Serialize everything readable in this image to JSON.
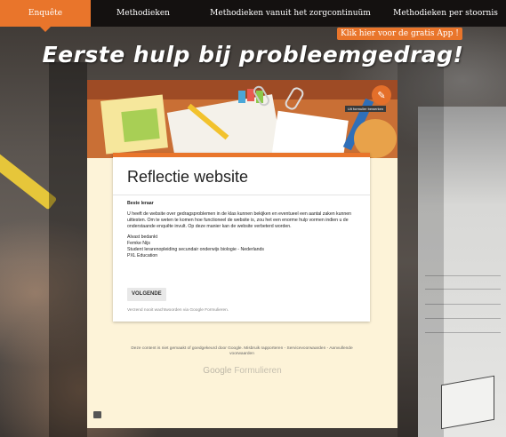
{
  "nav": {
    "items": [
      {
        "label": "Enquête",
        "active": true
      },
      {
        "label": "Methodieken",
        "active": false
      },
      {
        "label": "Methodieken vanuit het zorgcontinuüm",
        "active": false
      },
      {
        "label": "Methodieken per stoornis",
        "active": false
      }
    ]
  },
  "app_banner": "Klik hier voor de gratis App !",
  "headline": "Eerste hulp bij probleemgedrag!",
  "form": {
    "edit_tooltip": "Uit formulier bewerken",
    "title": "Reflectie website",
    "greeting": "Beste leraar",
    "intro": "U heeft de website over gedragsproblemen in de klas kunnen bekijken en eventueel een aantal zaken kunnen uittesten. Om te weten te komen hoe functioneel de website is, zou het een enorme hulp vormen indien u de onderstaande enquête invult. Op deze manier kan de website verbeterd worden.",
    "thanks": "Alvast bedankt",
    "signature_name": "Femke Nijs",
    "signature_role": "Student lerarenopleiding secundair onderwijs biologie - Nederlands",
    "signature_org": "PXL Education",
    "next_button": "VOLGENDE",
    "password_note": "Verzend nooit wachtwoorden via Google Formulieren.",
    "footer": "Deze content is niet gemaakt of goedgekeurd door Google. Misbruik rapporteren - Servicevoorwaarden - Aanvullende voorwaarden",
    "brand_google": "Google",
    "brand_forms": "Formulieren"
  },
  "colors": {
    "accent": "#e9752b",
    "nav_bg": "#141110",
    "form_bg": "#fdf3d8"
  },
  "icons": [
    "pencil-edit-icon",
    "report-flag-icon"
  ]
}
